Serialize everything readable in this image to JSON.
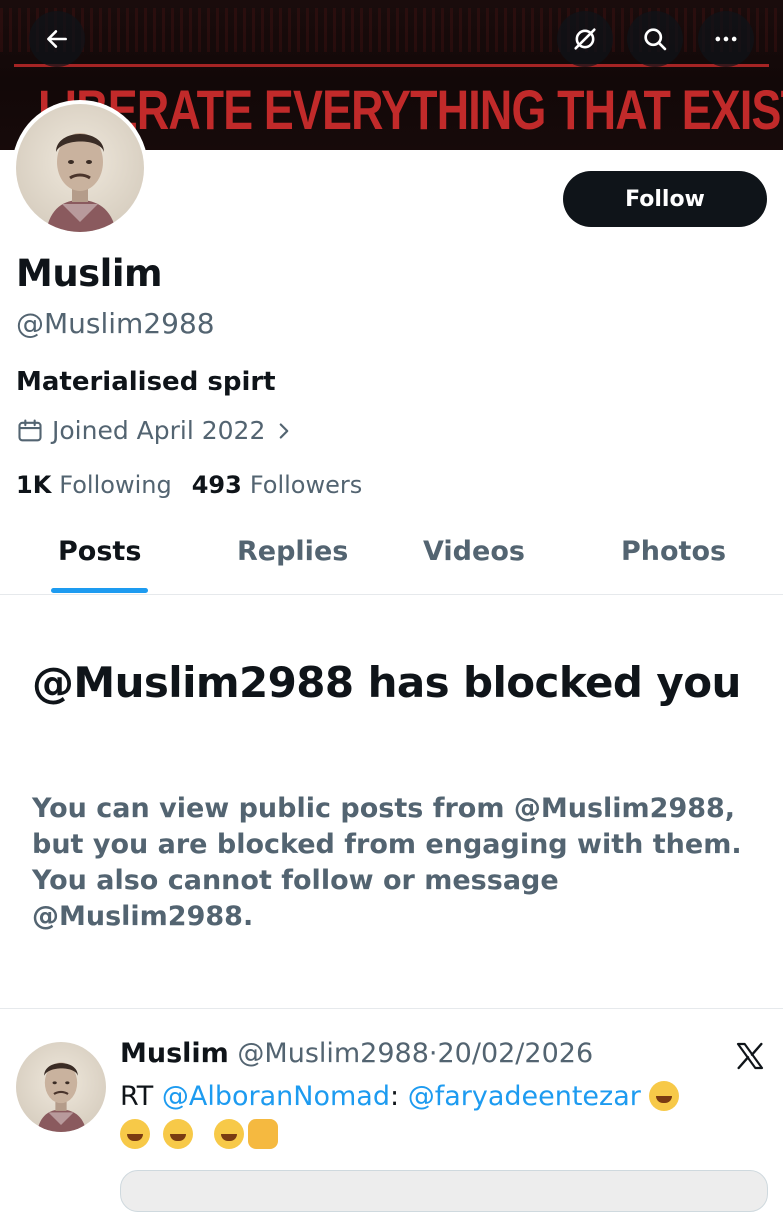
{
  "header": {
    "banner_text": "LIBERATE EVERYTHING THAT EXISTS.",
    "back_icon": "arrow-left-icon",
    "grok_icon": "grok-icon",
    "search_icon": "search-icon",
    "more_icon": "more-horizontal-icon"
  },
  "profile": {
    "display_name": "Muslim",
    "handle": "@Muslim2988",
    "bio": "Materialised spirt",
    "joined": "Joined April 2022",
    "following_count": "1K",
    "following_label": "Following",
    "followers_count": "493",
    "followers_label": "Followers",
    "follow_label": "Follow"
  },
  "tabs": [
    {
      "label": "Posts",
      "active": true
    },
    {
      "label": "Replies",
      "active": false
    },
    {
      "label": "Videos",
      "active": false
    },
    {
      "label": "Photos",
      "active": false
    }
  ],
  "blocked": {
    "title": "@Muslim2988 has blocked you",
    "description": "You can view public posts from @Muslim2988, but you are blocked from engaging with them. You also cannot follow or message @Muslim2988."
  },
  "post": {
    "author_name": "Muslim",
    "author_handle": "@Muslim2988",
    "separator": "·",
    "date": "20/02/2026",
    "rt_prefix": "RT",
    "rt_mention": "@AlboranNomad",
    "colon": ":",
    "reply_mention": "@faryadeentezar",
    "emoji_names": [
      "rolling-on-floor-laughing",
      "rolling-on-floor-laughing",
      "rolling-on-floor-laughing",
      "face-with-tears-of-joy",
      "oncoming-fist"
    ]
  },
  "colors": {
    "accent": "#1d9bf0",
    "text_primary": "#0f1419",
    "text_secondary": "#536471",
    "banner_red": "#c12a2a"
  }
}
